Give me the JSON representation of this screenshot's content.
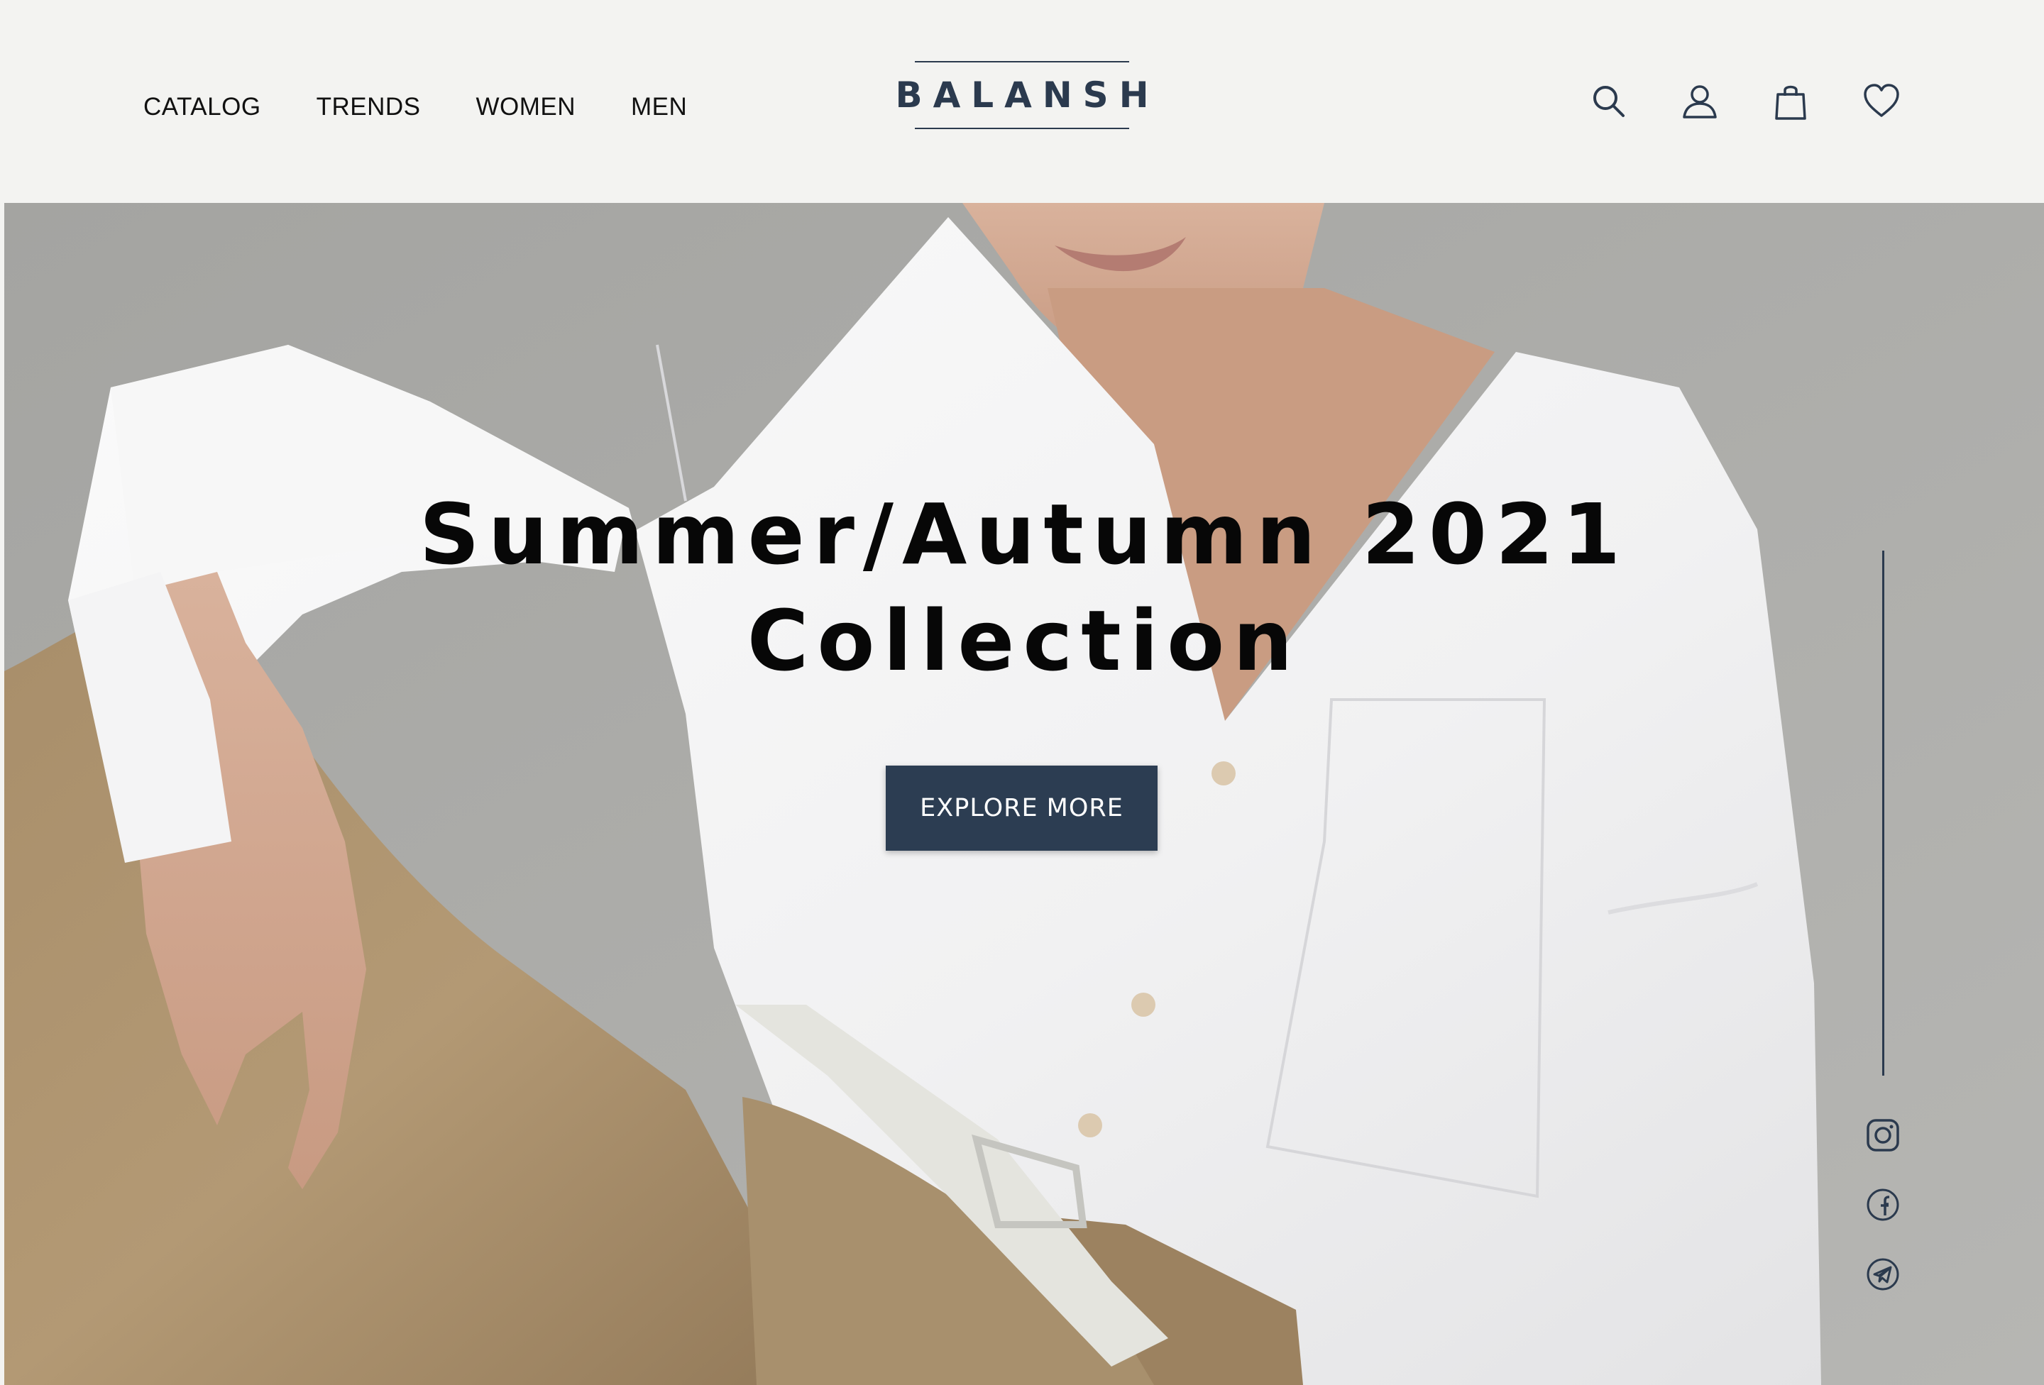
{
  "nav": {
    "items": [
      {
        "label": "CATALOG"
      },
      {
        "label": "TRENDS"
      },
      {
        "label": "WOMEN"
      },
      {
        "label": "MEN"
      }
    ]
  },
  "brand": {
    "logo_text": "BALANSH",
    "color": "#2b3a4e"
  },
  "header_icons": [
    "search-icon",
    "user-icon",
    "shopping-bag-icon",
    "heart-icon"
  ],
  "hero": {
    "headline_line1": "Summer/Autumn 2021",
    "headline_line2": "Collection",
    "cta_label": "EXPLORE MORE",
    "cta_color": "#2c3d52"
  },
  "social_icons": [
    "instagram-icon",
    "facebook-icon",
    "telegram-icon"
  ]
}
